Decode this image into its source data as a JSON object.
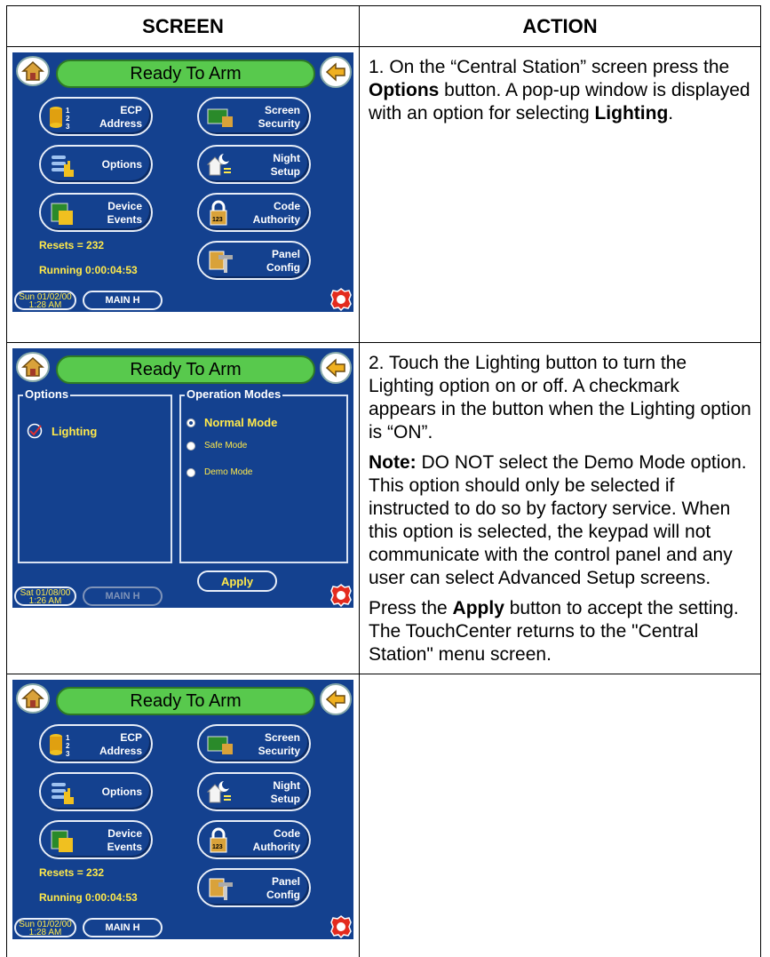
{
  "table": {
    "header_screen": "SCREEN",
    "header_action": "ACTION"
  },
  "screens": {
    "status": "Ready To Arm",
    "buttons": {
      "ecp": "ECP\nAddress",
      "screen_security": "Screen\nSecurity",
      "options": "Options",
      "night_setup": "Night\nSetup",
      "device_events": "Device\nEvents",
      "code_authority": "Code\nAuthority",
      "panel_config": "Panel\nConfig"
    },
    "resets": "Resets = 232",
    "running": "Running 0:00:04:53",
    "date_1": "Sun 01/02/00",
    "time_1": "1:28 AM",
    "date_2": "Sat 01/08/00",
    "time_2": "1:26 AM",
    "main_button": "MAIN H",
    "options_group": "Options",
    "lighting": "Lighting",
    "operation_modes_group": "Operation Modes",
    "normal_mode": "Normal Mode",
    "safe_mode": "Safe Mode",
    "demo_mode": "Demo Mode",
    "apply": "Apply"
  },
  "actions": {
    "step1_a": "1.  On the “Central Station” screen press the ",
    "step1_b": "Options",
    "step1_c": " button.  A pop-up window is displayed with an option for selecting ",
    "step1_d": "Lighting",
    "step1_e": ".",
    "step2": "2.  Touch the Lighting button to turn the Lighting option on or off. A checkmark appears in the button when the Lighting option is “ON”.",
    "note_label": "Note:",
    "note_text": " DO NOT select the Demo Mode option. This option should only be selected if instructed to do so by factory service. When this option is selected, the keypad will not communicate with the control panel and any user can select Advanced Setup screens.",
    "press_a": "Press the ",
    "press_b": "Apply",
    "press_c": " button to accept the setting.  The TouchCenter returns to the \"Central Station\" menu screen."
  },
  "colors": {
    "screen_bg": "#14418f",
    "status_green": "#58c94d",
    "label_yellow": "#ffe94a"
  }
}
